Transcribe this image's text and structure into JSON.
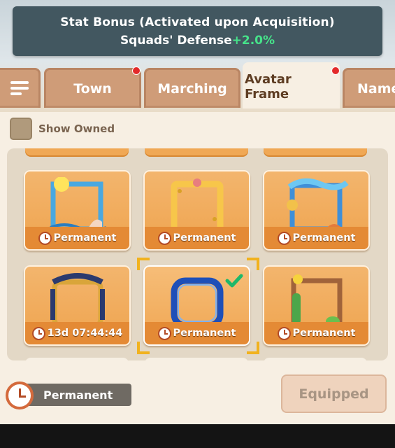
{
  "header": {
    "line1": "Stat Bonus (Activated upon Acquisition)",
    "line2_prefix": "Squads' Defense",
    "line2_bonus": "+2.0%",
    "bonus_color": "#46e38a"
  },
  "tabs": {
    "menu_icon": "sort-menu-icon",
    "town": "Town",
    "marching": "Marching",
    "avatar_frame": "Avatar Frame",
    "name": "Name"
  },
  "filter": {
    "show_owned_label": "Show Owned",
    "show_owned_checked": false
  },
  "frames": [
    {
      "duration": "Permanent",
      "theme": "ocean-sun-frame"
    },
    {
      "duration": "Permanent",
      "theme": "sponge-frame"
    },
    {
      "duration": "Permanent",
      "theme": "wave-banner-frame"
    },
    {
      "duration": "13d 07:44:44",
      "theme": "royal-gold-frame"
    },
    {
      "duration": "Permanent",
      "theme": "blue-swirl-frame",
      "selected": true,
      "equipped_check": true
    },
    {
      "duration": "Permanent",
      "theme": "desert-cactus-frame"
    }
  ],
  "selected_duration": "Permanent",
  "equip_button_label": "Equipped"
}
